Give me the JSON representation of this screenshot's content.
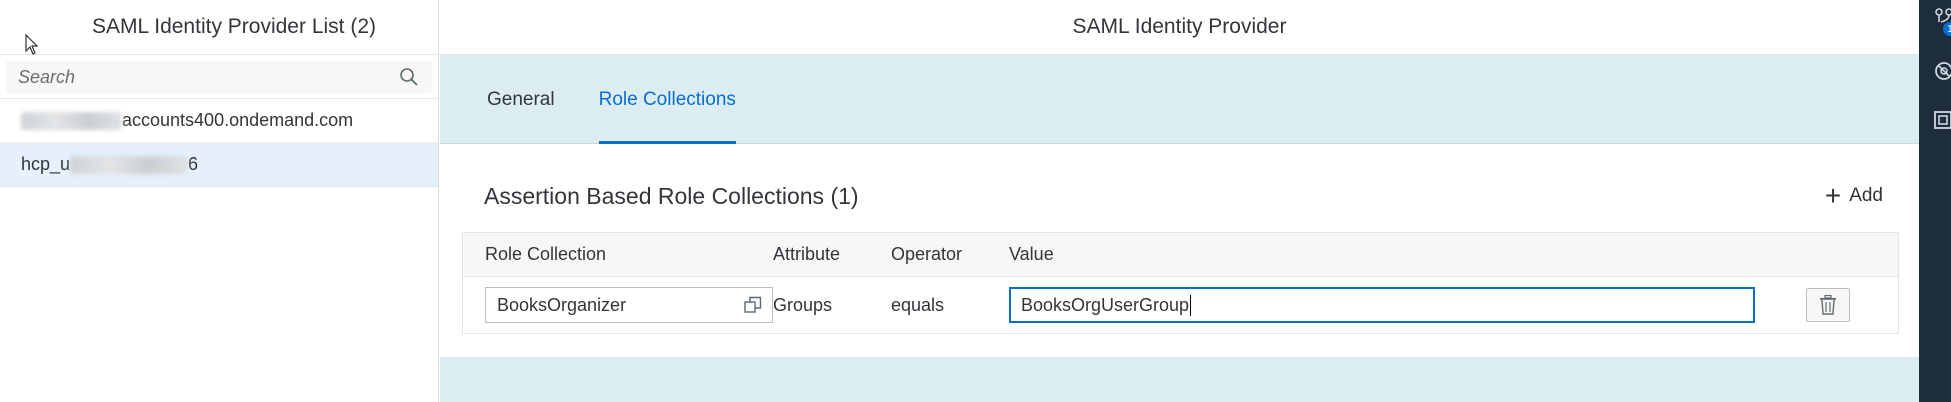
{
  "master": {
    "title": "SAML Identity Provider List (2)",
    "search_placeholder": "Search",
    "items": [
      {
        "visible_text": "accounts400.ondemand.com",
        "blurred_prefix": true,
        "selected": false
      },
      {
        "visible_prefix": "hcp_u",
        "visible_suffix": "6",
        "blurred_middle": true,
        "selected": true
      }
    ]
  },
  "detail": {
    "title": "SAML Identity Provider",
    "tabs": [
      {
        "label": "General",
        "active": false
      },
      {
        "label": "Role Collections",
        "active": true
      }
    ],
    "section": {
      "title": "Assertion Based Role Collections (1)",
      "add_label": "Add"
    },
    "table": {
      "columns": [
        "Role Collection",
        "Attribute",
        "Operator",
        "Value"
      ],
      "rows": [
        {
          "role_collection": "BooksOrganizer",
          "attribute": "Groups",
          "operator": "equals",
          "value": "BooksOrgUserGroup"
        }
      ]
    }
  },
  "shell": {
    "notification_count": "1",
    "icons": [
      "notifications-icon",
      "settings-icon",
      "apps-icon"
    ]
  },
  "colors": {
    "accent": "#0a6ed1",
    "tab_band": "#dcedf1",
    "selected_row": "#e5f0fa",
    "shell_strip": "#1d2d3e"
  }
}
